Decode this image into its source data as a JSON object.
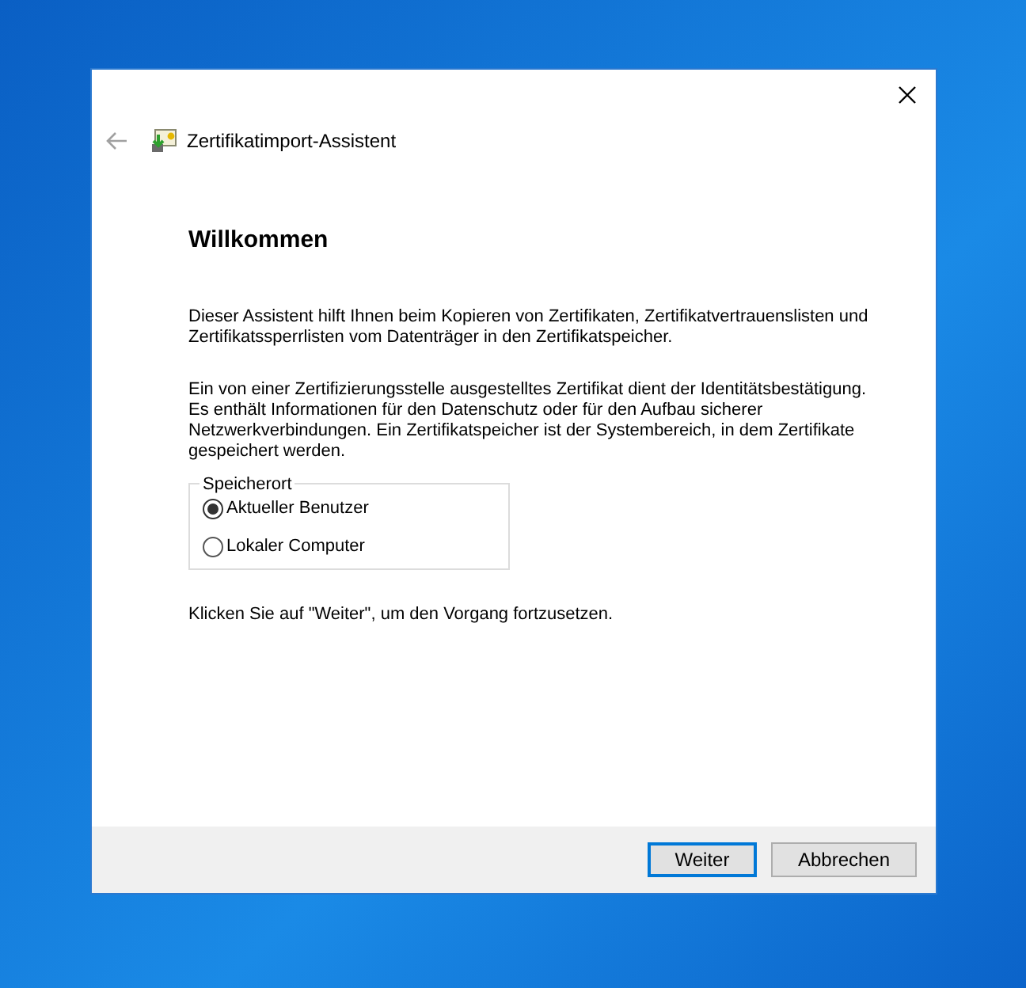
{
  "window": {
    "title": "Zertifikatimport-Assistent"
  },
  "heading": "Willkommen",
  "paragraphs": [
    "Dieser Assistent hilft Ihnen beim Kopieren von Zertifikaten, Zertifikatvertrauenslisten und Zertifikatssperrlisten vom Datenträger in den Zertifikatspeicher.",
    "Ein von einer Zertifizierungsstelle ausgestelltes Zertifikat dient der Identitätsbestätigung. Es enthält Informationen für den Datenschutz oder für den Aufbau sicherer Netzwerkverbindungen. Ein Zertifikatspeicher ist der Systembereich, in dem Zertifikate gespeichert werden."
  ],
  "store_location": {
    "label": "Speicherort",
    "options": [
      {
        "label": "Aktueller Benutzer",
        "selected": true
      },
      {
        "label": "Lokaler Computer",
        "selected": false
      }
    ]
  },
  "hint": "Klicken Sie auf \"Weiter\", um den Vorgang fortzusetzen.",
  "buttons": [
    {
      "label": "Weiter",
      "default": true
    },
    {
      "label": "Abbrechen",
      "default": false
    }
  ]
}
